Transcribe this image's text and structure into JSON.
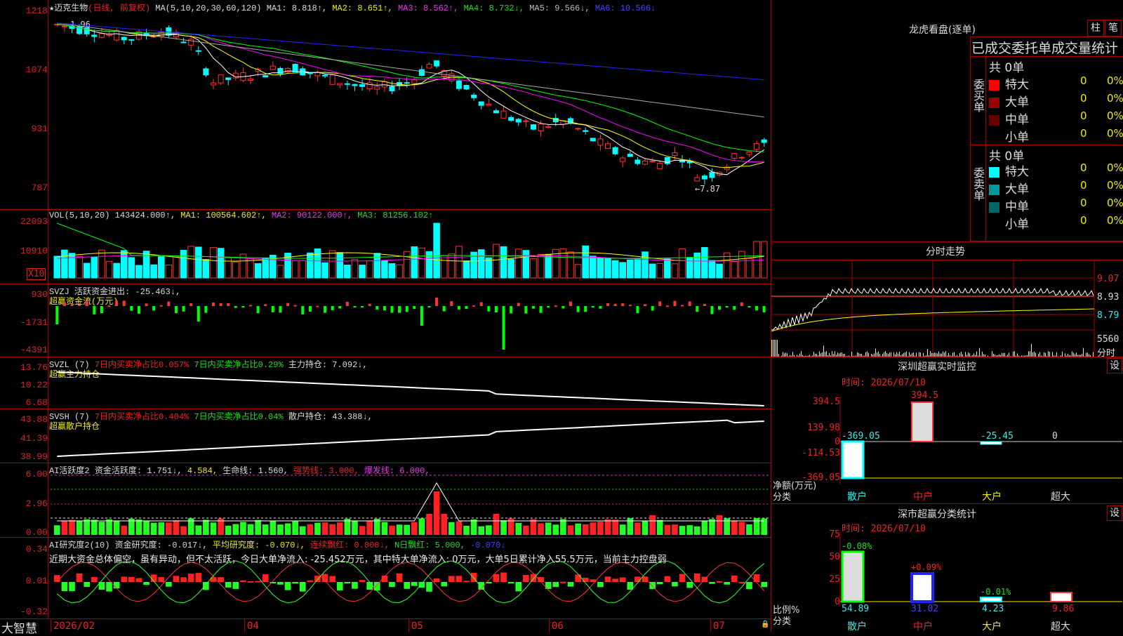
{
  "main_chart": {
    "star": "★",
    "stock_name": "迈克生物",
    "mode": "(日线, 前复权)",
    "ma_label": "MA(5,10,20,30,60,120)",
    "ma1": "MA1: 8.818↑,",
    "ma2": "MA2: 8.651↑,",
    "ma3": "MA3: 8.562↑,",
    "ma4": "MA4: 8.732↓,",
    "ma5": "MA5: 9.566↓,",
    "ma6": "MA6: 10.566↓",
    "axis": [
      "1218",
      "1074",
      "931",
      "787"
    ],
    "high_mark": "1.96",
    "low_mark": "←7.87",
    "colors": {
      "ma1": "#ffffff",
      "ma2": "#ffff00",
      "ma3": "#ff00ff",
      "ma4": "#00ff00",
      "ma5": "#aaaaaa",
      "ma6": "#2222ff"
    }
  },
  "vol_chart": {
    "label": "VOL(5,10,20)",
    "value": "143424.000↑,",
    "ma1": "MA1: 100564.602↑,",
    "ma2": "MA2: 90122.000↑,",
    "ma3": "MA3: 81256.102↑",
    "axis": [
      "22093",
      "10910"
    ],
    "unit": "X10"
  },
  "svzj": {
    "label": "SVZJ",
    "text": "活跃资金进出: -25.463↓,",
    "subtitle": "超赢资金流(万元)",
    "axis": [
      "930",
      "-1731",
      "-4391"
    ]
  },
  "svzl": {
    "label": "SVZL (7)",
    "t1": "7日内买卖净占比0.057%",
    "t2": "7日内买卖净占比0.29%",
    "t3": "主力持仓: 7.092↓,",
    "subtitle": "超赢主力持仓",
    "axis": [
      "13.76",
      "10.22",
      "6.68"
    ]
  },
  "svsh": {
    "label": "SVSH (7)",
    "t1": "7日内买卖净占比0.404%",
    "t2": "7日内买卖净占比0.04%",
    "t3": "散户持仓: 43.388↓,",
    "subtitle": "超赢散户持仓",
    "axis": [
      "43.88",
      "41.39",
      "38.99"
    ]
  },
  "ai_active": {
    "label": "AI活跃度2",
    "t1": "资金活跃度: 1.751↓,",
    "t2": "4.584,",
    "t3": "生命线: 1.560,",
    "t4": "强势线: 3.000,",
    "t5": "爆发线: 6.000,",
    "axis": [
      "6.00",
      "2.96",
      "0.00"
    ]
  },
  "ai_research": {
    "label": "AI研究度2(10)",
    "t1": "资金研究度: -0.017↓,",
    "t2": "平均研究度: -0.070↓,",
    "t3": "连续飘红: 0.000↓,",
    "t4": "N日飘红: 5.000,",
    "t5": "-0.070↓",
    "comment": "近期大资金总体偏空，虽有异动，但不太活跃，今日大单净流入: -25.452万元，其中特大单净流入: 0万元，大单5日累计净入55.5万元，当前主力控盘弱",
    "axis": [
      "0.34",
      "0.01",
      "-0.32"
    ]
  },
  "bottom": {
    "brand": "大智慧",
    "dates": [
      "2026/02",
      "04",
      "05",
      "06",
      "07"
    ]
  },
  "right": {
    "title": "龙虎看盘(逐单)",
    "btn1": "柱",
    "btn2": "笔",
    "table_title": "已成交委托单成交量统计",
    "buy_label": "委买单",
    "sell_label": "委卖单",
    "buy_total": "共 0单",
    "sell_total": "共 0单",
    "buy_rows": [
      {
        "name": "特大",
        "count": "0",
        "pct": "0%",
        "color": "#ff0000"
      },
      {
        "name": "大单",
        "count": "0",
        "pct": "0%",
        "color": "#990000"
      },
      {
        "name": "中单",
        "count": "0",
        "pct": "0%",
        "color": "#660000"
      },
      {
        "name": "小单",
        "count": "0",
        "pct": "0%",
        "color": "#000000"
      }
    ],
    "sell_rows": [
      {
        "name": "特大",
        "count": "0",
        "pct": "0%",
        "color": "#00ffff"
      },
      {
        "name": "大单",
        "count": "0",
        "pct": "0%",
        "color": "#009999"
      },
      {
        "name": "中单",
        "count": "0",
        "pct": "0%",
        "color": "#006666"
      },
      {
        "name": "小单",
        "count": "0",
        "pct": "0%",
        "color": "#000000"
      }
    ],
    "intraday_title": "分时走势",
    "intraday_axis": [
      "9.07",
      "8.93",
      "8.79"
    ],
    "intraday_vol": "5560",
    "intraday_vol_label": "分时",
    "monitor_title": "深圳超赢实时监控",
    "monitor_btn": "设",
    "monitor_time": "时间: 2026/07/10",
    "monitor_axis": [
      "394.5",
      "139.98",
      "0",
      "-114.53",
      "-369.05"
    ],
    "monitor_values": [
      "-369.05",
      "394.5",
      "-25.45",
      "0"
    ],
    "monitor_ylabel": "净额(万元)",
    "monitor_xlabel": "分类",
    "monitor_cats": [
      "散户",
      "中户",
      "大户",
      "超大"
    ],
    "stats_title": "深市超赢分类统计",
    "stats_btn": "设",
    "stats_time": "时间: 2026/07/10",
    "stats_axis": [
      "75",
      "50",
      "25",
      "0"
    ],
    "stats_top": [
      "-0.08%",
      "+0.09%",
      "-0.01%"
    ],
    "stats_bottom": [
      "54.89",
      "31.02",
      "4.23",
      "9.86"
    ],
    "stats_ylabel": "比例%",
    "stats_xlabel": "分类",
    "stats_cats": [
      "散户",
      "中户",
      "大户",
      "超大"
    ]
  },
  "chart_data": {
    "type": "candlestick",
    "title": "迈克生物 (日线, 前复权)",
    "ylim": [
      7.87,
      12.18
    ],
    "x_ticks": [
      "2026/02",
      "04",
      "05",
      "06",
      "07"
    ],
    "monitor": {
      "type": "bar",
      "categories": [
        "散户",
        "中户",
        "大户",
        "超大"
      ],
      "values": [
        -369.05,
        394.5,
        -25.45,
        0
      ]
    },
    "stats": {
      "type": "bar",
      "categories": [
        "散户",
        "中户",
        "大户",
        "超大"
      ],
      "values": [
        54.89,
        31.02,
        4.23,
        9.86
      ],
      "changes": [
        "-0.08%",
        "+0.09%",
        "-0.01%",
        ""
      ]
    }
  }
}
